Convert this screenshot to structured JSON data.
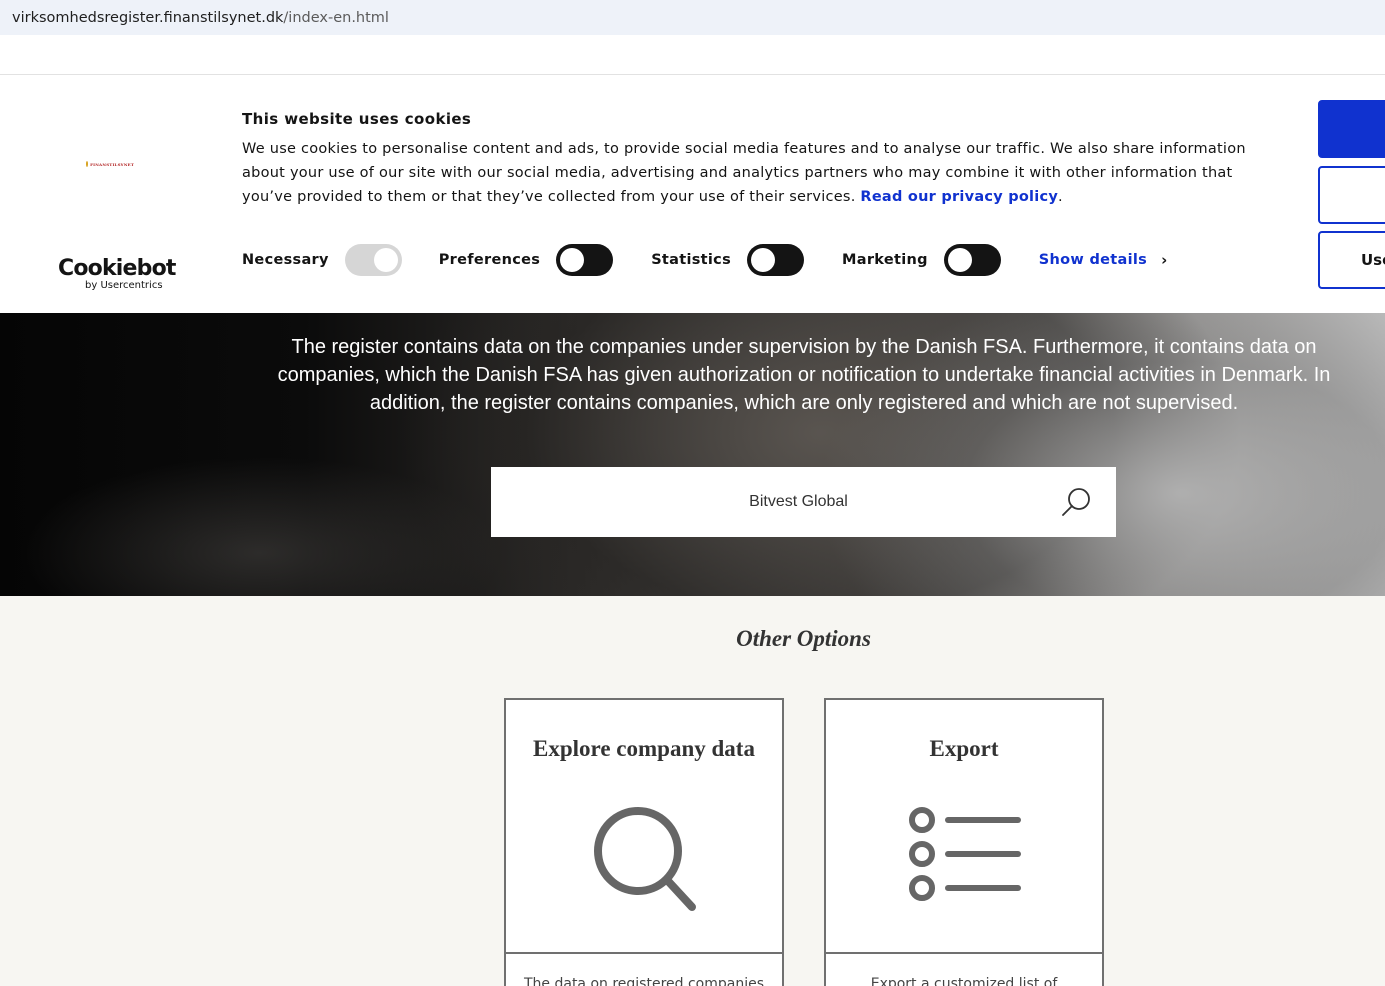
{
  "browser": {
    "url_host": "virksomhedsregister.finanstilsynet.dk",
    "url_path": "/index-en.html"
  },
  "cookie_banner": {
    "site_logo_text": "FINANSTILSYNET",
    "brand_name": "Cookiebot",
    "brand_sub": "by Usercentrics",
    "title": "This website uses cookies",
    "body": "We use cookies to personalise content and ads, to provide social media features and to analyse our traffic. We also share information about your use of our site with our social media, advertising and analytics partners who may combine it with other information that you’ve provided to them or that they’ve collected from your use of their services.",
    "privacy_link": "Read our privacy policy",
    "privacy_suffix": ".",
    "toggles": [
      {
        "label": "Necessary",
        "on": true,
        "disabled": true
      },
      {
        "label": "Preferences",
        "on": false,
        "disabled": false
      },
      {
        "label": "Statistics",
        "on": false,
        "disabled": false
      },
      {
        "label": "Marketing",
        "on": false,
        "disabled": false
      }
    ],
    "show_details": "Show details",
    "buttons": [
      "",
      "",
      "Use"
    ],
    "accent_color": "#1032cf"
  },
  "hero": {
    "description": "The register contains data on the companies under supervision by the Danish FSA. Furthermore, it contains data on companies, which the Danish FSA has given authorization or notification to undertake financial activities in Denmark. In addition, the register contains companies, which are only registered and which are not supervised.",
    "search_value": "Bitvest Global",
    "search_icon": "search-icon"
  },
  "options": {
    "heading": "Other Options",
    "cards": [
      {
        "title": "Explore company data",
        "icon": "magnifier-icon",
        "description": "The data on registered companies"
      },
      {
        "title": "Export",
        "icon": "list-icon",
        "description": "Export a customized list of"
      }
    ]
  }
}
